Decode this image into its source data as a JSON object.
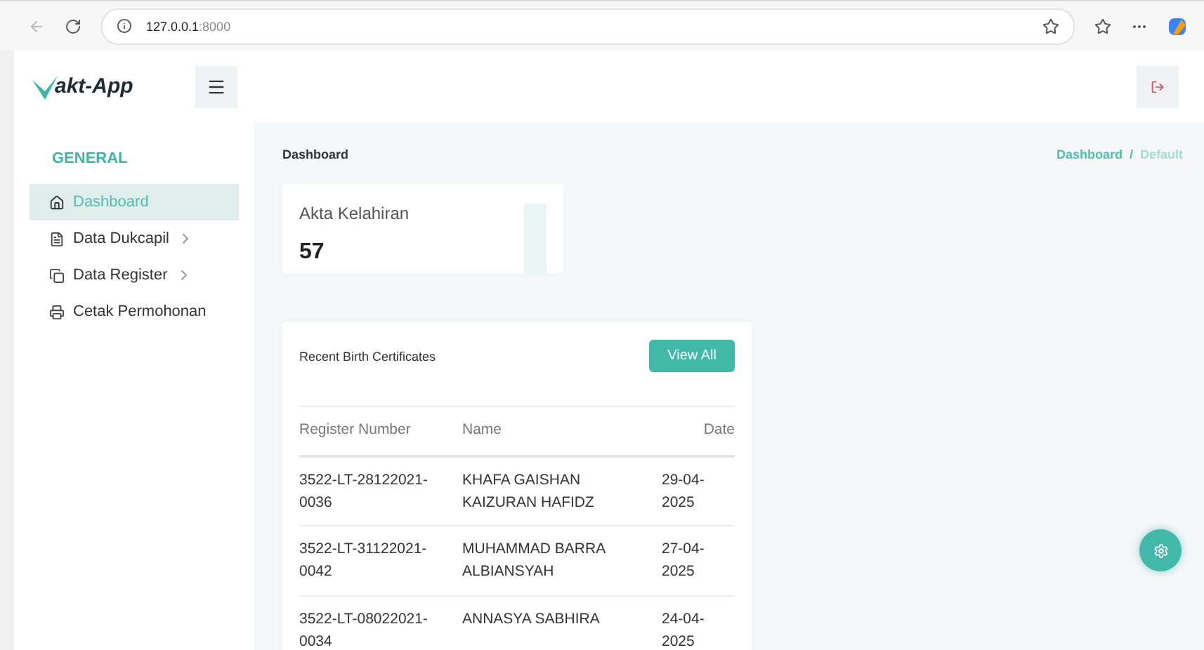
{
  "browser": {
    "url_host": "127.0.0.1",
    "url_port": ":8000"
  },
  "header": {
    "logo_text": "akt-App"
  },
  "sidebar": {
    "heading": "GENERAL",
    "items": [
      {
        "label": "Dashboard",
        "selected": true,
        "has_submenu": false
      },
      {
        "label": "Data Dukcapil",
        "selected": false,
        "has_submenu": true
      },
      {
        "label": "Data Register",
        "selected": false,
        "has_submenu": true
      },
      {
        "label": "Cetak Permohonan",
        "selected": false,
        "has_submenu": false
      }
    ]
  },
  "page_title": "Dashboard",
  "breadcrumb": [
    {
      "label": "Dashboard",
      "selected": false
    },
    {
      "label": "Default",
      "selected": true
    }
  ],
  "breadcrumb_separator": "/",
  "stat_card": {
    "label": "Akta Kelahiran",
    "value": "57"
  },
  "recent": {
    "title": "Recent Birth Certificates",
    "button": "View All",
    "columns": [
      "Register Number",
      "Name",
      "Date"
    ],
    "rows": [
      [
        "3522-LT-28122021-0036",
        "KHAFA GAISHAN KAIZURAN HAFIDZ",
        "29-04-2025"
      ],
      [
        "3522-LT-31122021-0042",
        "MUHAMMAD BARRA ALBIANSYAH",
        "27-04-2025"
      ],
      [
        "3522-LT-08022021-0034",
        "ANNASYA SABHIRA",
        "24-04-2025"
      ]
    ]
  }
}
